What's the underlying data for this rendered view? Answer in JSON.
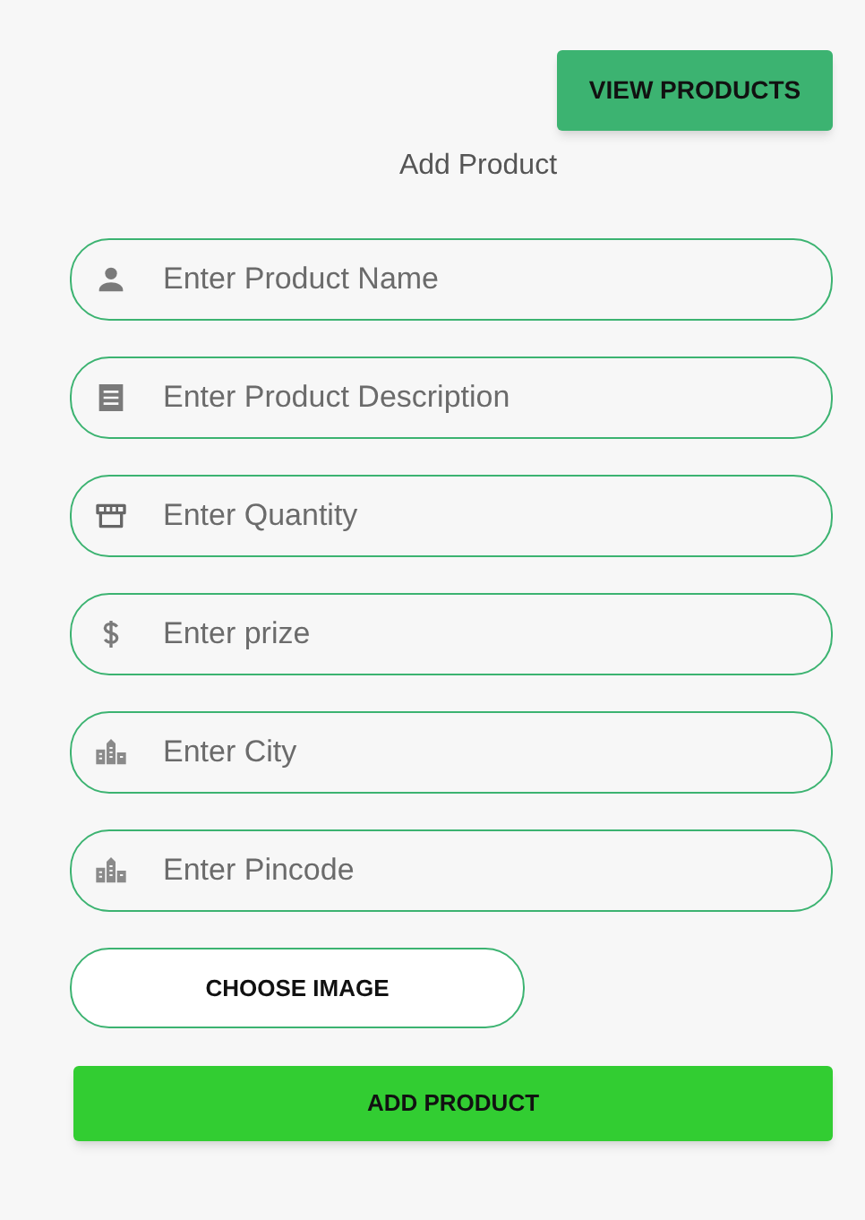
{
  "view_button": "VIEW PRODUCTS",
  "title": "Add Product",
  "fields": [
    {
      "placeholder": "Enter Product Name",
      "kind": "person"
    },
    {
      "placeholder": "Enter Product Description",
      "kind": "receipt"
    },
    {
      "placeholder": "Enter Quantity",
      "kind": "store"
    },
    {
      "placeholder": "Enter prize",
      "kind": "dollar"
    },
    {
      "placeholder": "Enter City",
      "kind": "city"
    },
    {
      "placeholder": "Enter Pincode",
      "kind": "city"
    }
  ],
  "choose_button": "CHOOSE IMAGE",
  "submit_button": "ADD PRODUCT"
}
